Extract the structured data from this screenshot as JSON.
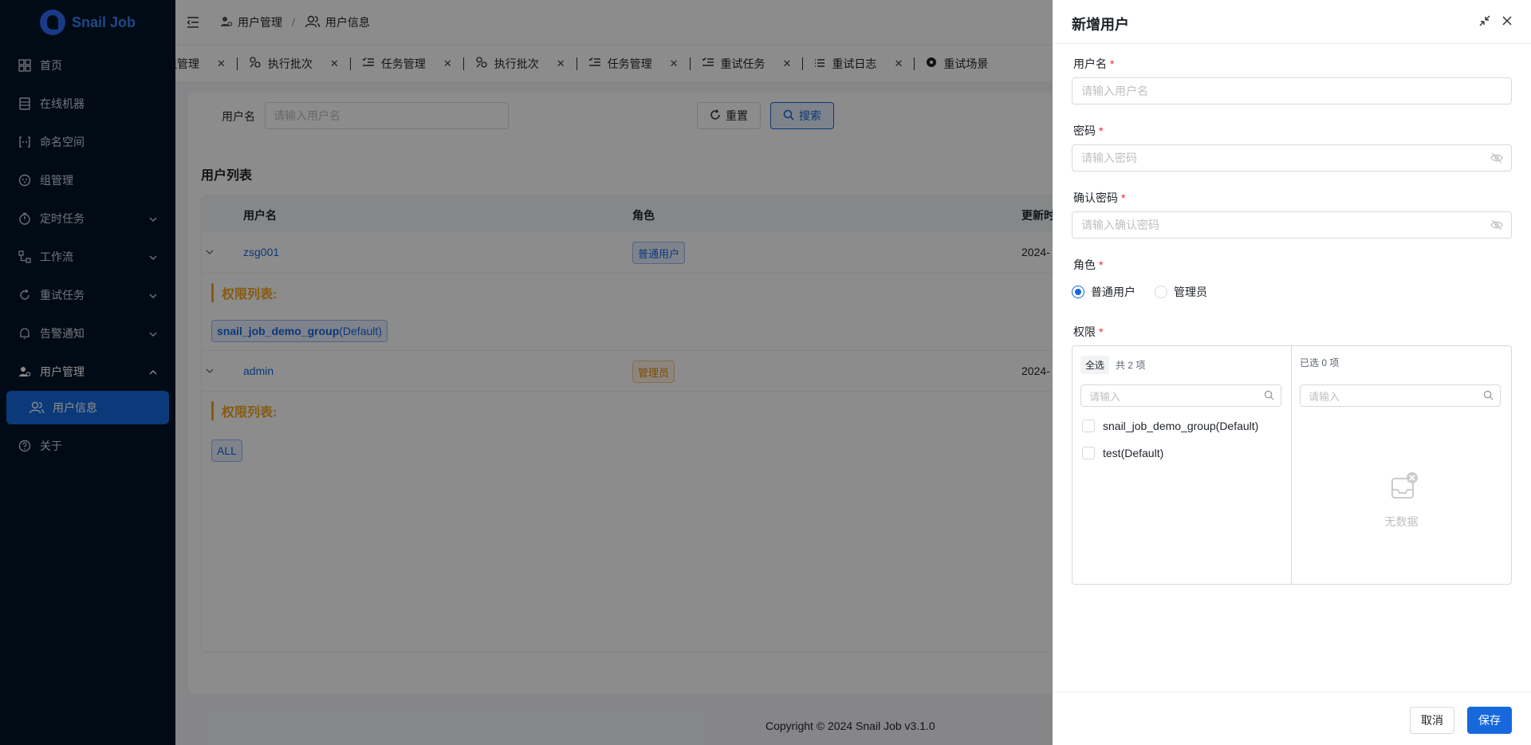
{
  "app": {
    "name": "Snail Job"
  },
  "sidebar": {
    "items": [
      {
        "label": "首页",
        "icon": "dashboard-icon"
      },
      {
        "label": "在线机器",
        "icon": "server-icon"
      },
      {
        "label": "命名空间",
        "icon": "namespace-icon"
      },
      {
        "label": "组管理",
        "icon": "group-icon"
      },
      {
        "label": "定时任务",
        "icon": "timer-icon"
      },
      {
        "label": "工作流",
        "icon": "workflow-icon"
      },
      {
        "label": "重试任务",
        "icon": "retry-icon"
      },
      {
        "label": "告警通知",
        "icon": "bell-icon"
      },
      {
        "label": "用户管理",
        "icon": "user-manage-icon"
      },
      {
        "label": "用户信息",
        "icon": "users-icon"
      },
      {
        "label": "关于",
        "icon": "help-icon"
      }
    ]
  },
  "breadcrumb": {
    "parent": "用户管理",
    "current": "用户信息"
  },
  "tabs": [
    {
      "label": "组管理"
    },
    {
      "label": "执行批次"
    },
    {
      "label": "任务管理"
    },
    {
      "label": "执行批次"
    },
    {
      "label": "任务管理"
    },
    {
      "label": "重试任务"
    },
    {
      "label": "重试日志"
    },
    {
      "label": "重试场景"
    }
  ],
  "search": {
    "label": "用户名",
    "placeholder": "请输入用户名",
    "reset": "重置",
    "submit": "搜索"
  },
  "user_list": {
    "title": "用户列表",
    "columns": {
      "username": "用户名",
      "role": "角色",
      "updated": "更新时"
    },
    "rows": [
      {
        "username": "zsg001",
        "role": "普通用户",
        "updated": "2024-",
        "perm_title": "权限列表:",
        "perm_name": "snail_job_demo_group",
        "perm_suffix": "(Default)"
      },
      {
        "username": "admin",
        "role": "管理员",
        "updated": "2024-",
        "perm_title": "权限列表:",
        "perm_name": "ALL",
        "perm_suffix": ""
      }
    ]
  },
  "footer": {
    "text": "Copyright © 2024 Snail Job v3.1.0"
  },
  "drawer": {
    "title": "新增用户",
    "username": {
      "label": "用户名",
      "placeholder": "请输入用户名"
    },
    "password": {
      "label": "密码",
      "placeholder": "请输入密码"
    },
    "confirm": {
      "label": "确认密码",
      "placeholder": "请输入确认密码"
    },
    "role": {
      "label": "角色",
      "options": [
        "普通用户",
        "管理员"
      ],
      "selected": "普通用户"
    },
    "permission": {
      "label": "权限",
      "left": {
        "select_all": "全选",
        "count": "共 2 项",
        "placeholder": "请输入",
        "items": [
          "snail_job_demo_group(Default)",
          "test(Default)"
        ]
      },
      "right": {
        "count": "已选 0 项",
        "placeholder": "请输入",
        "empty": "无数据"
      }
    },
    "cancel": "取消",
    "save": "保存"
  },
  "colors": {
    "primary": "#1668dc",
    "sidebar_bg": "#001428",
    "warning": "#f5a623"
  }
}
